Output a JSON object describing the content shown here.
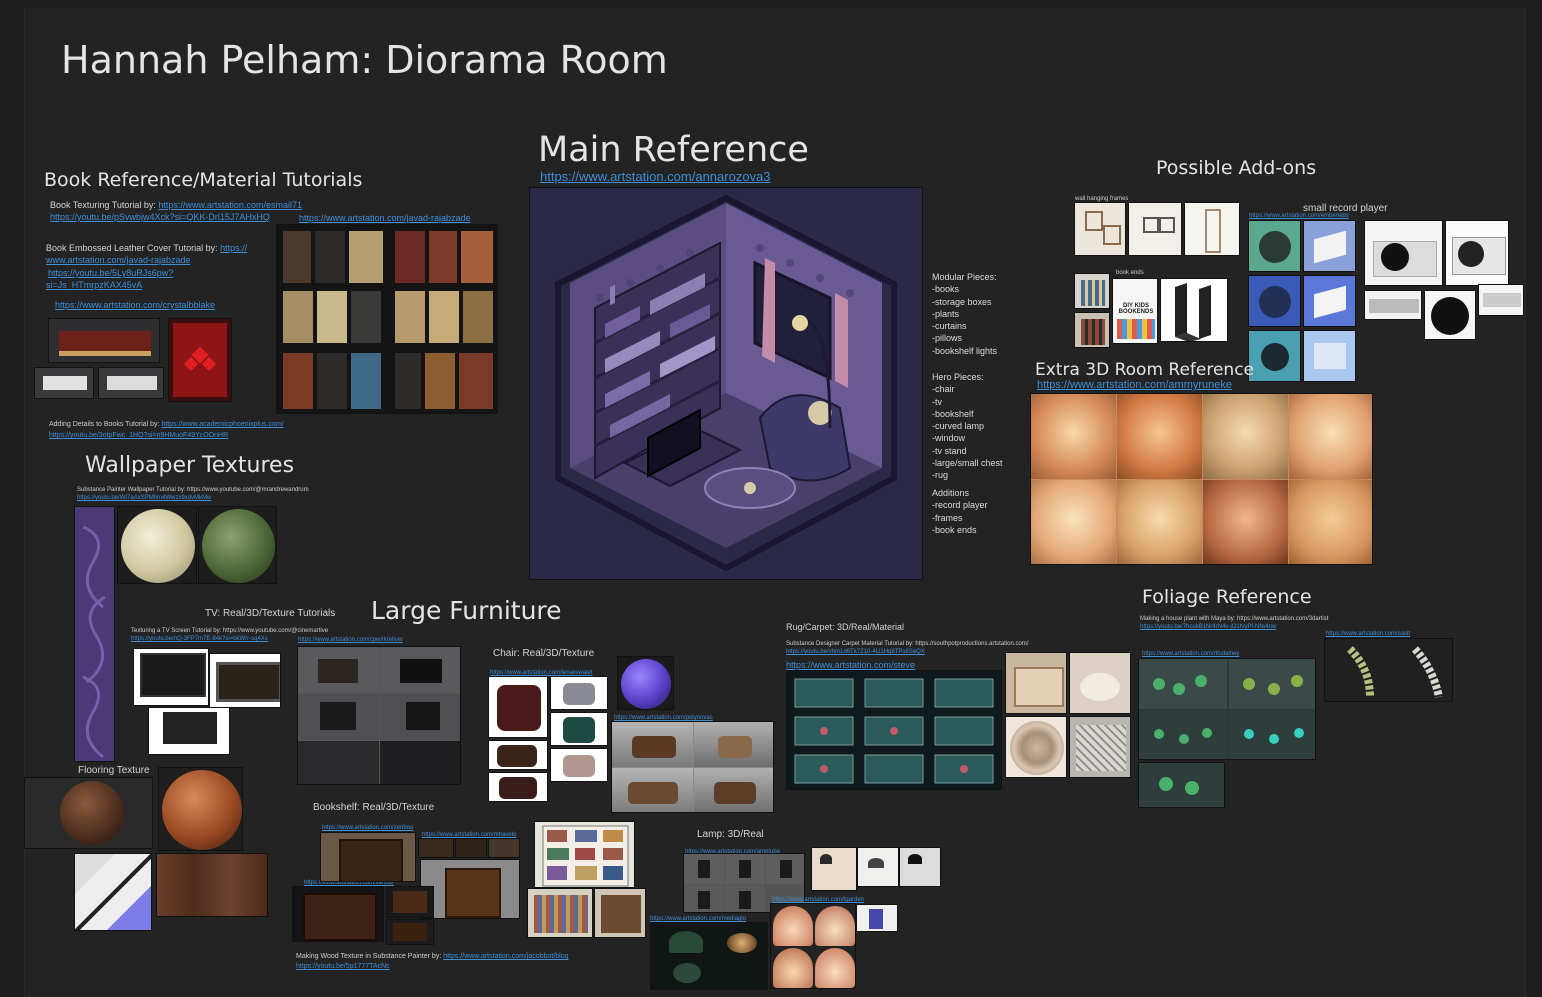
{
  "title": "Hannah Pelham: Diorama Room",
  "main_reference": {
    "heading": "Main Reference",
    "link": "https://www.artstation.com/annarozova3"
  },
  "modular_pieces": [
    "Modular Pieces:",
    "-books",
    "-storage boxes",
    "-plants",
    "-curtains",
    "-pillows",
    "-bookshelf lights"
  ],
  "hero_pieces": [
    "Hero Pieces:",
    "-chair",
    "-tv",
    "-bookshelf",
    "-curved lamp",
    "-window",
    "-tv stand",
    "-large/small chest",
    "-rug"
  ],
  "additions": [
    "Additions",
    "-record player",
    "-frames",
    "-book ends"
  ],
  "book_section": {
    "heading": "Book Reference/Material Tutorials",
    "tex_tutorial_prefix": "Book Texturing Tutorial by: ",
    "tex_tutorial_link": "https://www.artstation.com/esmail71",
    "tex_tutorial_yt": "https://youtu.be/pSvwbjw4Xck?si=QKK-Drl15J7AHxHQ",
    "javad_link": "https://www.artstation.com/javad-rajabzade",
    "emboss_line1": "Book Embossed Leather Cover Tutorial by: ",
    "emboss_link1": "https://",
    "emboss_line2": "www.artstation.com/javad-rajabzade",
    "emboss_yt1": "https://youtu.be/5Ly8uRJs6pw?",
    "emboss_yt2": "si=Js_HTmrpzKAX45vA",
    "crystal_link": "https://www.artstation.com/crystalbblake",
    "details_prefix": "Adding Details to Books Tutorial by: ",
    "details_link": "https://www.academicphoenixplus.com/",
    "details_yt": "https://youtu.be/3otpFwc_1HQ?si=n9HMuoF49YcOOnHR"
  },
  "wallpaper": {
    "heading": "Wallpaper Textures",
    "tutorial": "Substance Painter Wallpaper Tutorial by: https://www.youtube.com/@mrandrewandrum",
    "yt": "https://youtu.be/WI7aAxSPMhm4Wwzx9xdvMkMw"
  },
  "flooring": {
    "label": "Flooring Texture"
  },
  "tv": {
    "label": "TV: Real/3D/Texture Tutorials",
    "tutorial": "Texturing a TV Screen Tutorial by: https://www.youtube.com/@cinemartive",
    "yt": "https://youtu.be/nQ-3FP7m7E-84k?si=bkWrr-sq4Xs",
    "link": "https://www.artstation.com/cpwirkreliver"
  },
  "large_furniture": {
    "heading": "Large Furniture"
  },
  "chair": {
    "label": "Chair: Real/3D/Texture",
    "link1": "https://www.artstation.com/lenarewalet",
    "link2": "https://www.artstation.com/polynovas"
  },
  "bookshelf": {
    "label": "Bookshelf: Real/3D/Texture",
    "link1": "https://www.artstation.com/zenboo",
    "link2": "https://www.artstation.com/mhavelo",
    "link3": "https://www.artstation.com/vendor",
    "wood_prefix": "Making Wood Texture in Substance Painter by: ",
    "wood_link": "https://www.artstation.com/jacobbot/blog",
    "wood_yt": "https://youtu.be/5p1777TAcNc"
  },
  "lamp": {
    "label": "Lamp: 3D/Real",
    "link1": "https://www.artstation.com/amptube",
    "link2": "https://www.artstation.com/tgarden",
    "link3": "https://www.artstation.com/mediaglo"
  },
  "rug": {
    "label": "Rug/Carpet: 3D/Real/Material",
    "tutorial": "Substance Designer Carpet Material Tutorial by: https://southpotproductions.artstation.com/",
    "yt": "https://youtu.be/vhm1d6Tk7Z10-4Ll1Hq8TPs8SeQX",
    "link": "https://www.artstation.com/steve"
  },
  "addons": {
    "heading": "Possible Add-ons",
    "wall_frames": "wall hanging frames",
    "book_ends": "book ends",
    "record_player": "small record player",
    "record_link": "https://www.artstation.com/emberlabs"
  },
  "extra_room": {
    "heading": "Extra 3D Room Reference",
    "link": "https://www.artstation.com/ammyruneke"
  },
  "foliage": {
    "heading": "Foliage Reference",
    "tutorial": "Making a house plant with Maya by: https://www.artstation.com/3dartist",
    "yt": "https://youtu.be/7hcukB1Nr4rN4v-jO1fvyPf-Nfw4nw",
    "link1": "https://www.artstation.com/sasit",
    "link2": "https://www.artstation.com/rtisdalney"
  },
  "colors": {
    "board": "#232324",
    "link": "#3f8fd8",
    "text": "#e4e4e4"
  }
}
